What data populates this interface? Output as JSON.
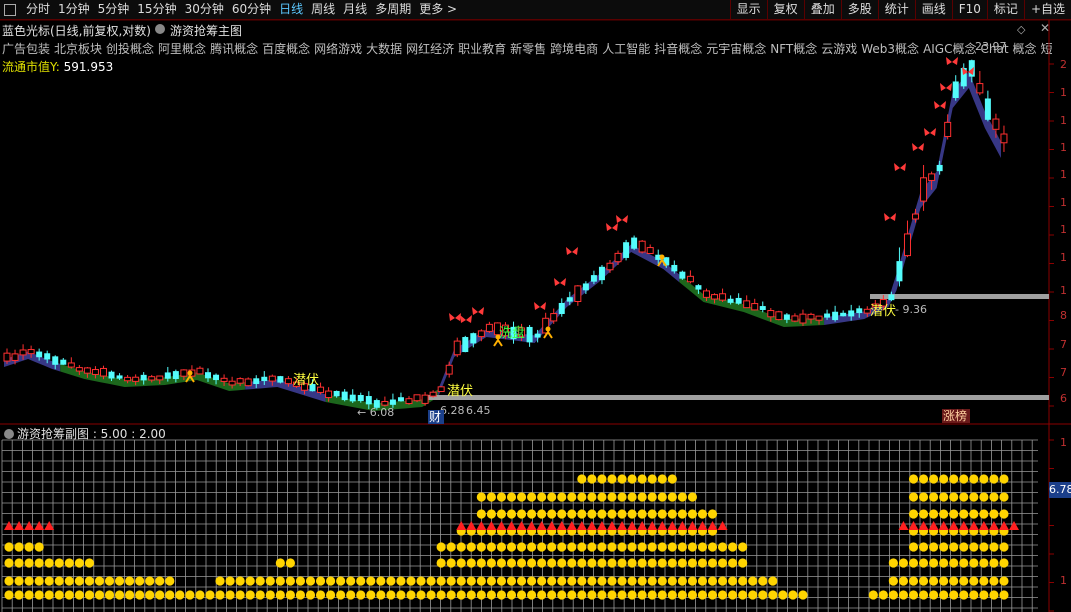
{
  "toolbar": {
    "periods": [
      "分时",
      "1分钟",
      "5分钟",
      "15分钟",
      "30分钟",
      "60分钟",
      "日线",
      "周线",
      "月线",
      "多周期",
      "更多 >"
    ],
    "active_period": "日线",
    "buttons": [
      "显示",
      "复权",
      "叠加",
      "多股",
      "统计",
      "画线",
      "F10",
      "标记",
      "+自选"
    ]
  },
  "main_chart": {
    "title": "蓝色光标(日线,前复权,对数)",
    "indicator": "游资抢筹主图",
    "concepts": [
      "广告包装",
      "北京板块",
      "创投概念",
      "阿里概念",
      "腾讯概念",
      "百度概念",
      "网络游戏",
      "大数据",
      "网红经济",
      "职业教育",
      "新零售",
      "跨境电商",
      "人工智能",
      "抖音概念",
      "元宇宙概念",
      "NFT概念",
      "云游戏",
      "Web3概念",
      "AIGC概念",
      "Chat",
      "概念",
      "短剧"
    ],
    "market_cap_label": "流通市值Y:",
    "market_cap_value": "591.953",
    "annotations": {
      "latent1": "潜伏",
      "latent2": "潜伏",
      "latent3": "潜伏",
      "wash": "洗盘",
      "low1": "6.08",
      "low2": "6.28",
      "low3": "6.45",
      "low4": "9.36",
      "high": "23.97",
      "cai": "财",
      "zhangbang": "涨榜"
    },
    "colors": {
      "up": "#ff3030",
      "down": "#54fcfc",
      "band_up": "#3a3a8c",
      "band_down": "#1d6b1d",
      "support": "#a0a0a0",
      "signal": "#ffe000"
    }
  },
  "sub_chart": {
    "title": "游资抢筹副图 : 5.00 : 2.00",
    "right_value": "6.78"
  }
}
